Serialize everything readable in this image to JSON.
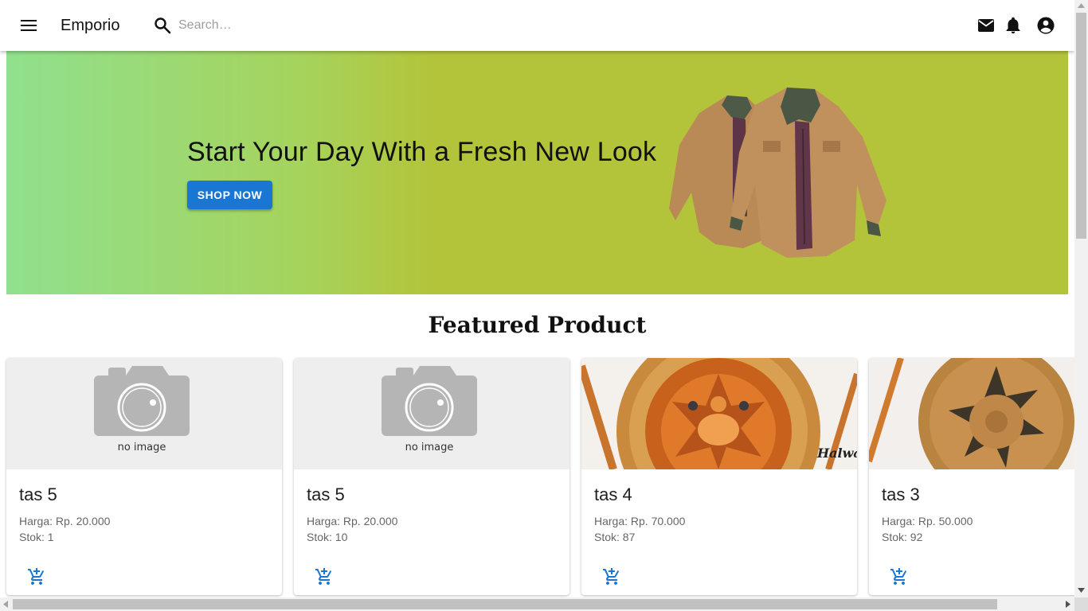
{
  "app": {
    "brand": "Emporio",
    "search_placeholder": "Search…"
  },
  "icons": {
    "menu": "menu-icon",
    "search": "search-icon",
    "mail": "mail-icon",
    "notifications": "bell-icon",
    "account": "account-circle-icon",
    "cart": "add-shopping-cart-icon"
  },
  "colors": {
    "primary": "#1976d2",
    "banner_start": "#90e08e",
    "banner_end": "#b3c43a"
  },
  "banner": {
    "headline": "Start Your Day With a Fresh New Look",
    "cta_label": "SHOP NOW"
  },
  "featured": {
    "title": "Featured Product"
  },
  "products": [
    {
      "name": "tas 5",
      "price": "Harga: Rp. 20.000",
      "stock": "Stok: 1",
      "image_text": "no image"
    },
    {
      "name": "tas 5",
      "price": "Harga: Rp. 20.000",
      "stock": "Stok: 10",
      "image_text": "no image"
    },
    {
      "name": "tas 4",
      "price": "Harga: Rp. 70.000",
      "stock": "Stok: 87",
      "image_text": "Halwa"
    },
    {
      "name": "tas 3",
      "price": "Harga: Rp. 50.000",
      "stock": "Stok: 92",
      "image_text": ""
    }
  ]
}
